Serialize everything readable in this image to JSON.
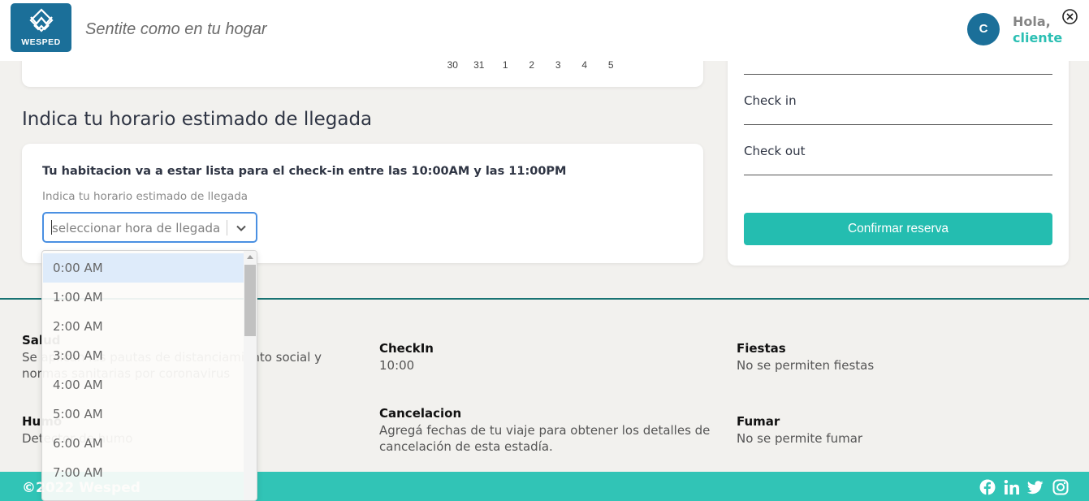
{
  "header": {
    "logo_text": "WESPED",
    "tagline": "Sentite como en tu hogar",
    "avatar_initial": "C",
    "greeting": "Hola,",
    "username": "cliente"
  },
  "calendar": {
    "days": [
      "30",
      "31",
      "1",
      "2",
      "3",
      "4",
      "5"
    ]
  },
  "arrival": {
    "title": "Indica tu horario estimado de llegada",
    "info": "Tu habitacion va a estar lista para el check-in entre las 10:00AM y las 11:00PM",
    "label": "Indica tu horario estimado de llegada",
    "select_placeholder": "seleccionar hora de llegada",
    "options": [
      "0:00 AM",
      "1:00 AM",
      "2:00 AM",
      "3:00 AM",
      "4:00 AM",
      "5:00 AM",
      "6:00 AM",
      "7:00 AM"
    ],
    "highlighted_option": "0:00 AM"
  },
  "booking_panel": {
    "checkin_label": "Check in",
    "checkout_label": "Check out",
    "confirm_label": "Confirmar reserva"
  },
  "policies": {
    "salud_title": "Salud",
    "salud_text": "Se aplican las pautas de distanciamiento social y normas sanitarias por coronavirus",
    "checkin_title": "CheckIn",
    "checkin_text": "10:00",
    "fiestas_title": "Fiestas",
    "fiestas_text": "No se permiten fiestas",
    "humo_title": "Humo",
    "humo_text": "Detector de humo",
    "cancelacion_title": "Cancelacion",
    "cancelacion_text": "Agregá fechas de tu viaje para obtener los detalles de cancelación de esta estadía.",
    "fumar_title": "Fumar",
    "fumar_text": "No se permite fumar"
  },
  "footer": {
    "copyright": "©2022 Wesped",
    "social_icons": [
      "facebook-icon",
      "linkedin-icon",
      "twitter-icon",
      "instagram-icon"
    ]
  },
  "colors": {
    "brand_blue": "#1b6f99",
    "accent_teal": "#24bdb0",
    "footer_teal": "#31c4b6",
    "divider": "#197373",
    "focus_blue": "#4a90e2"
  }
}
